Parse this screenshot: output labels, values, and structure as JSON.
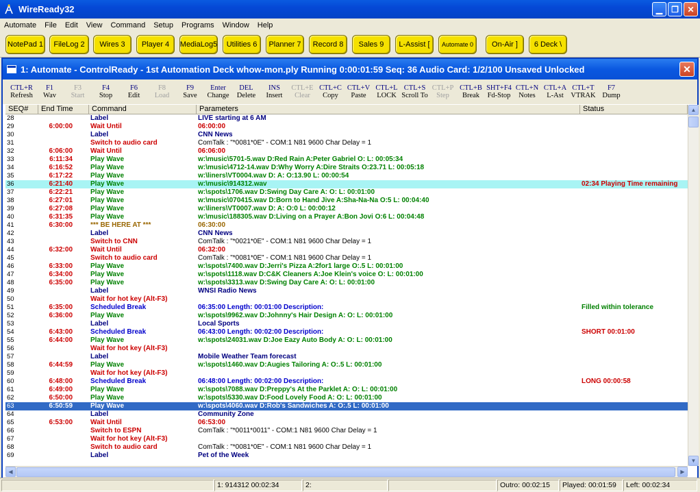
{
  "app": {
    "title": "WireReady32",
    "menu": [
      "Automate",
      "File",
      "Edit",
      "View",
      "Command",
      "Setup",
      "Programs",
      "Window",
      "Help"
    ],
    "decks": [
      "NotePad 1",
      "FileLog 2",
      "Wires 3",
      "Player 4",
      "MediaLog5",
      "Utilities 6",
      "Planner 7",
      "Record 8",
      "Sales 9",
      "L-Assist [",
      "Automate 0",
      "On-Air ]",
      "6 Deck \\"
    ]
  },
  "window": {
    "title": "1: Automate - ControlReady - 1st Automation Deck  whow-mon.ply  Running 0:00:01:59  Seq: 36 Audio Card: 1/2/100 Unsaved Unlocked"
  },
  "toolbar": [
    {
      "key": "CTL+R",
      "label": "Refresh",
      "enabled": true
    },
    {
      "key": "F1",
      "label": "Wav",
      "enabled": true
    },
    {
      "key": "F3",
      "label": "Start",
      "enabled": false
    },
    {
      "key": "F4",
      "label": "Stop",
      "enabled": true
    },
    {
      "key": "F6",
      "label": "Edit",
      "enabled": true
    },
    {
      "key": "F8",
      "label": "Load",
      "enabled": false
    },
    {
      "key": "F9",
      "label": "Save",
      "enabled": true
    },
    {
      "key": "Enter",
      "label": "Change",
      "enabled": true
    },
    {
      "key": "DEL",
      "label": "Delete",
      "enabled": true
    },
    {
      "key": "INS",
      "label": "Insert",
      "enabled": true
    },
    {
      "key": "CTL+E",
      "label": "Clear",
      "enabled": false
    },
    {
      "key": "CTL+C",
      "label": "Copy",
      "enabled": true
    },
    {
      "key": "CTL+V",
      "label": "Paste",
      "enabled": true
    },
    {
      "key": "CTL+L",
      "label": "LOCK",
      "enabled": true
    },
    {
      "key": "CTL+S",
      "label": "Scroll To",
      "enabled": true
    },
    {
      "key": "CTL+P",
      "label": "Step",
      "enabled": false
    },
    {
      "key": "CTL+B",
      "label": "Break",
      "enabled": true
    },
    {
      "key": "SHT+F4",
      "label": "Fd-Stop",
      "enabled": true
    },
    {
      "key": "CTL+N",
      "label": "Notes",
      "enabled": true
    },
    {
      "key": "CTL+A",
      "label": "L-Ast",
      "enabled": true
    },
    {
      "key": "CTL+T",
      "label": "VTRAK",
      "enabled": true
    },
    {
      "key": "F7",
      "label": "Dump",
      "enabled": true
    }
  ],
  "grid": {
    "columns": [
      "SEQ#",
      "End Time",
      "Command",
      "Parameters",
      "Status"
    ],
    "rows": [
      {
        "seq": "28",
        "end": "",
        "cmd": "Label",
        "par": "LIVE starting at 6 AM",
        "status": "",
        "kind": "label"
      },
      {
        "seq": "29",
        "end": "6:00:00",
        "cmd": "Wait Until",
        "par": "06:00:00",
        "status": "",
        "kind": "wait"
      },
      {
        "seq": "30",
        "end": "",
        "cmd": "Label",
        "par": "CNN News",
        "status": "",
        "kind": "label"
      },
      {
        "seq": "31",
        "end": "",
        "cmd": "Switch to audio card",
        "par": "ComTalk : \"*0081*0E\" - COM:1 N81 9600 Char Delay = 1",
        "status": "",
        "kind": "switch"
      },
      {
        "seq": "32",
        "end": "6:06:00",
        "cmd": "Wait Until",
        "par": "06:06:00",
        "status": "",
        "kind": "wait"
      },
      {
        "seq": "33",
        "end": "6:11:34",
        "cmd": "Play Wave",
        "par": "w:\\music\\5701-5.wav D:Red Rain A:Peter Gabriel O: L: 00:05:34",
        "status": "",
        "kind": "play"
      },
      {
        "seq": "34",
        "end": "6:16:52",
        "cmd": "Play Wave",
        "par": "w:\\music\\4712-14.wav D:Why Worry A:Dire Straits O:23.71 L: 00:05:18",
        "status": "",
        "kind": "play"
      },
      {
        "seq": "35",
        "end": "6:17:22",
        "cmd": "Play Wave",
        "par": "w:\\liners\\VT0004.wav D: A: O:13.90 L: 00:00:54",
        "status": "",
        "kind": "play"
      },
      {
        "seq": "36",
        "end": "6:21:40",
        "cmd": "Play Wave",
        "par": "w:\\music\\914312.wav",
        "status": "02:34 Playing Time remaining",
        "kind": "play",
        "hl": "cyan"
      },
      {
        "seq": "37",
        "end": "6:22:21",
        "cmd": "Play Wave",
        "par": "w:\\spots\\1706.wav D:Swing Day Care A: O: L: 00:01:00",
        "status": "",
        "kind": "play"
      },
      {
        "seq": "38",
        "end": "6:27:01",
        "cmd": "Play Wave",
        "par": "w:\\music\\070415.wav D:Born to Hand Jive A:Sha-Na-Na O:5 L: 00:04:40",
        "status": "",
        "kind": "play"
      },
      {
        "seq": "39",
        "end": "6:27:08",
        "cmd": "Play Wave",
        "par": "w:\\liners\\VT0007.wav D: A: O:0 L: 00:00:12",
        "status": "",
        "kind": "play"
      },
      {
        "seq": "40",
        "end": "6:31:35",
        "cmd": "Play Wave",
        "par": "w:\\music\\188305.wav D:Living on a Prayer A:Bon Jovi O:6 L: 00:04:48",
        "status": "",
        "kind": "play"
      },
      {
        "seq": "41",
        "end": "6:30:00",
        "cmd": "*** BE HERE AT ***",
        "par": "06:30:00",
        "status": "",
        "kind": "behere"
      },
      {
        "seq": "42",
        "end": "",
        "cmd": "Label",
        "par": "CNN News",
        "status": "",
        "kind": "label"
      },
      {
        "seq": "43",
        "end": "",
        "cmd": "Switch to CNN",
        "par": "ComTalk : \"*0021*0E\" - COM:1 N81 9600 Char Delay = 1",
        "status": "",
        "kind": "switch"
      },
      {
        "seq": "44",
        "end": "6:32:00",
        "cmd": "Wait Until",
        "par": "06:32:00",
        "status": "",
        "kind": "wait"
      },
      {
        "seq": "45",
        "end": "",
        "cmd": "Switch to audio card",
        "par": "ComTalk : \"*0081*0E\" - COM:1 N81 9600 Char Delay = 1",
        "status": "",
        "kind": "switch"
      },
      {
        "seq": "46",
        "end": "6:33:00",
        "cmd": "Play Wave",
        "par": "w:\\spots\\7400.wav D:Jerri's Pizza A:2for1 large O:.5 L: 00:01:00",
        "status": "",
        "kind": "play"
      },
      {
        "seq": "47",
        "end": "6:34:00",
        "cmd": "Play Wave",
        "par": "w:\\spots\\1118.wav D:C&K Cleaners A:Joe Klein's voice O: L: 00:01:00",
        "status": "",
        "kind": "play"
      },
      {
        "seq": "48",
        "end": "6:35:00",
        "cmd": "Play Wave",
        "par": "w:\\spots\\3313.wav D:Swing Day Care A: O: L: 00:01:00",
        "status": "",
        "kind": "play"
      },
      {
        "seq": "49",
        "end": "",
        "cmd": "Label",
        "par": "WNSI Radio News",
        "status": "",
        "kind": "label"
      },
      {
        "seq": "50",
        "end": "",
        "cmd": "Wait for hot key (Alt-F3)",
        "par": "",
        "status": "",
        "kind": "hotkey"
      },
      {
        "seq": "51",
        "end": "6:35:00",
        "cmd": "Scheduled Break",
        "par": "06:35:00 Length: 00:01:00 Description:",
        "status": "Filled within tolerance",
        "kind": "break",
        "statusKind": "ok"
      },
      {
        "seq": "52",
        "end": "6:36:00",
        "cmd": "Play Wave",
        "par": "w:\\spots\\9962.wav D:Johnny's Hair Design A: O: L: 00:01:00",
        "status": "",
        "kind": "play"
      },
      {
        "seq": "53",
        "end": "",
        "cmd": "Label",
        "par": "Local Sports",
        "status": "",
        "kind": "label"
      },
      {
        "seq": "54",
        "end": "6:43:00",
        "cmd": "Scheduled Break",
        "par": "06:43:00 Length: 00:02:00 Description:",
        "status": "SHORT 00:01:00",
        "kind": "break",
        "statusKind": "bad"
      },
      {
        "seq": "55",
        "end": "6:44:00",
        "cmd": "Play Wave",
        "par": "w:\\spots\\24031.wav D:Joe Eazy Auto Body A: O: L: 00:01:00",
        "status": "",
        "kind": "play"
      },
      {
        "seq": "56",
        "end": "",
        "cmd": "Wait for hot key (Alt-F3)",
        "par": "",
        "status": "",
        "kind": "hotkey"
      },
      {
        "seq": "57",
        "end": "",
        "cmd": "Label",
        "par": "Mobile Weather Team forecast",
        "status": "",
        "kind": "label"
      },
      {
        "seq": "58",
        "end": "6:44:59",
        "cmd": "Play Wave",
        "par": "w:\\spots\\1460.wav D:Augies Tailoring A: O:.5 L: 00:01:00",
        "status": "",
        "kind": "play"
      },
      {
        "seq": "59",
        "end": "",
        "cmd": "Wait for hot key (Alt-F3)",
        "par": "",
        "status": "",
        "kind": "hotkey"
      },
      {
        "seq": "60",
        "end": "6:48:00",
        "cmd": "Scheduled Break",
        "par": "06:48:00 Length: 00:02:00 Description:",
        "status": "LONG 00:00:58",
        "kind": "break",
        "statusKind": "bad"
      },
      {
        "seq": "61",
        "end": "6:49:00",
        "cmd": "Play Wave",
        "par": "w:\\spots\\7088.wav D:Preppy's At the Parklet A: O: L: 00:01:00",
        "status": "",
        "kind": "play"
      },
      {
        "seq": "62",
        "end": "6:50:00",
        "cmd": "Play Wave",
        "par": "w:\\spots\\5330.wav D:Food Lovely Food A: O: L: 00:01:00",
        "status": "",
        "kind": "play"
      },
      {
        "seq": "63",
        "end": "6:50:59",
        "cmd": "Play Wave",
        "par": "w:\\spots\\4060.wav D:Rob's Sandwiches A: O:.5 L: 00:01:00",
        "status": "",
        "kind": "play",
        "hl": "blue"
      },
      {
        "seq": "64",
        "end": "",
        "cmd": "Label",
        "par": "Community Zone",
        "status": "",
        "kind": "label"
      },
      {
        "seq": "65",
        "end": "6:53:00",
        "cmd": "Wait Until",
        "par": "06:53:00",
        "status": "",
        "kind": "wait"
      },
      {
        "seq": "66",
        "end": "",
        "cmd": "Switch to ESPN",
        "par": "ComTalk : \"*0011*0011\" - COM:1 N81 9600 Char Delay = 1",
        "status": "",
        "kind": "switch"
      },
      {
        "seq": "67",
        "end": "",
        "cmd": "Wait for hot key (Alt-F3)",
        "par": "",
        "status": "",
        "kind": "hotkey"
      },
      {
        "seq": "68",
        "end": "",
        "cmd": "Switch to audio card",
        "par": "ComTalk : \"*0081*0E\" - COM:1 N81 9600 Char Delay = 1",
        "status": "",
        "kind": "switch"
      },
      {
        "seq": "69",
        "end": "",
        "cmd": "Label",
        "par": "Pet of the Week",
        "status": "",
        "kind": "label"
      }
    ]
  },
  "statusbar": {
    "now_playing": "1: 914312 00:02:34",
    "deck2": "2:",
    "outro": "Outro: 00:02:15",
    "played": "Played: 00:01:59",
    "left": "Left: 00:02:34"
  },
  "colors": {
    "deck_yellow": "#f5e100",
    "label_blue": "#000080",
    "break_blue": "#0000cc",
    "wait_red": "#cc0000",
    "play_green": "#008000",
    "behere_brown": "#996600",
    "ok_green": "#008000",
    "bad_red": "#cc0000",
    "current_row": "#a8f4f4",
    "selected_row": "#316ac5"
  }
}
